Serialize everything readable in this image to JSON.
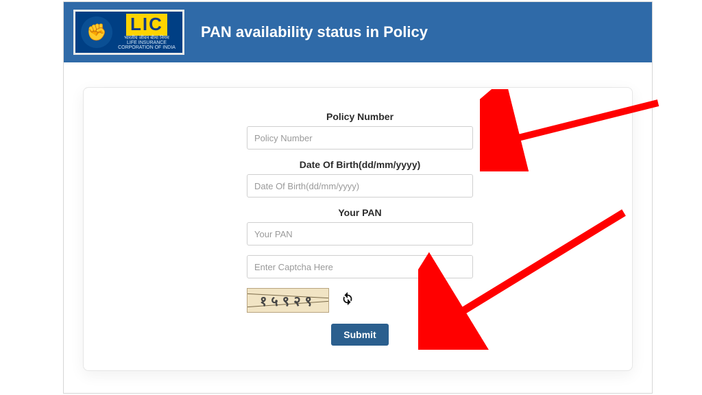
{
  "logo": {
    "company": "LIC",
    "tagline_top": "भारतीय जीवन बीमा निगम",
    "tagline_bottom": "LIFE INSURANCE CORPORATION OF INDIA",
    "emblem": "✊"
  },
  "header": {
    "title": "PAN availability status in Policy"
  },
  "form": {
    "policy": {
      "label": "Policy Number",
      "placeholder": "Policy Number",
      "value": ""
    },
    "dob": {
      "label": "Date Of Birth(dd/mm/yyyy)",
      "placeholder": "Date Of Birth(dd/mm/yyyy)",
      "value": ""
    },
    "pan": {
      "label": "Your PAN",
      "placeholder": "Your PAN",
      "value": ""
    },
    "captcha": {
      "placeholder": "Enter Captcha Here",
      "value": "",
      "image_text": "१५९२९"
    },
    "submit": {
      "label": "Submit"
    }
  }
}
